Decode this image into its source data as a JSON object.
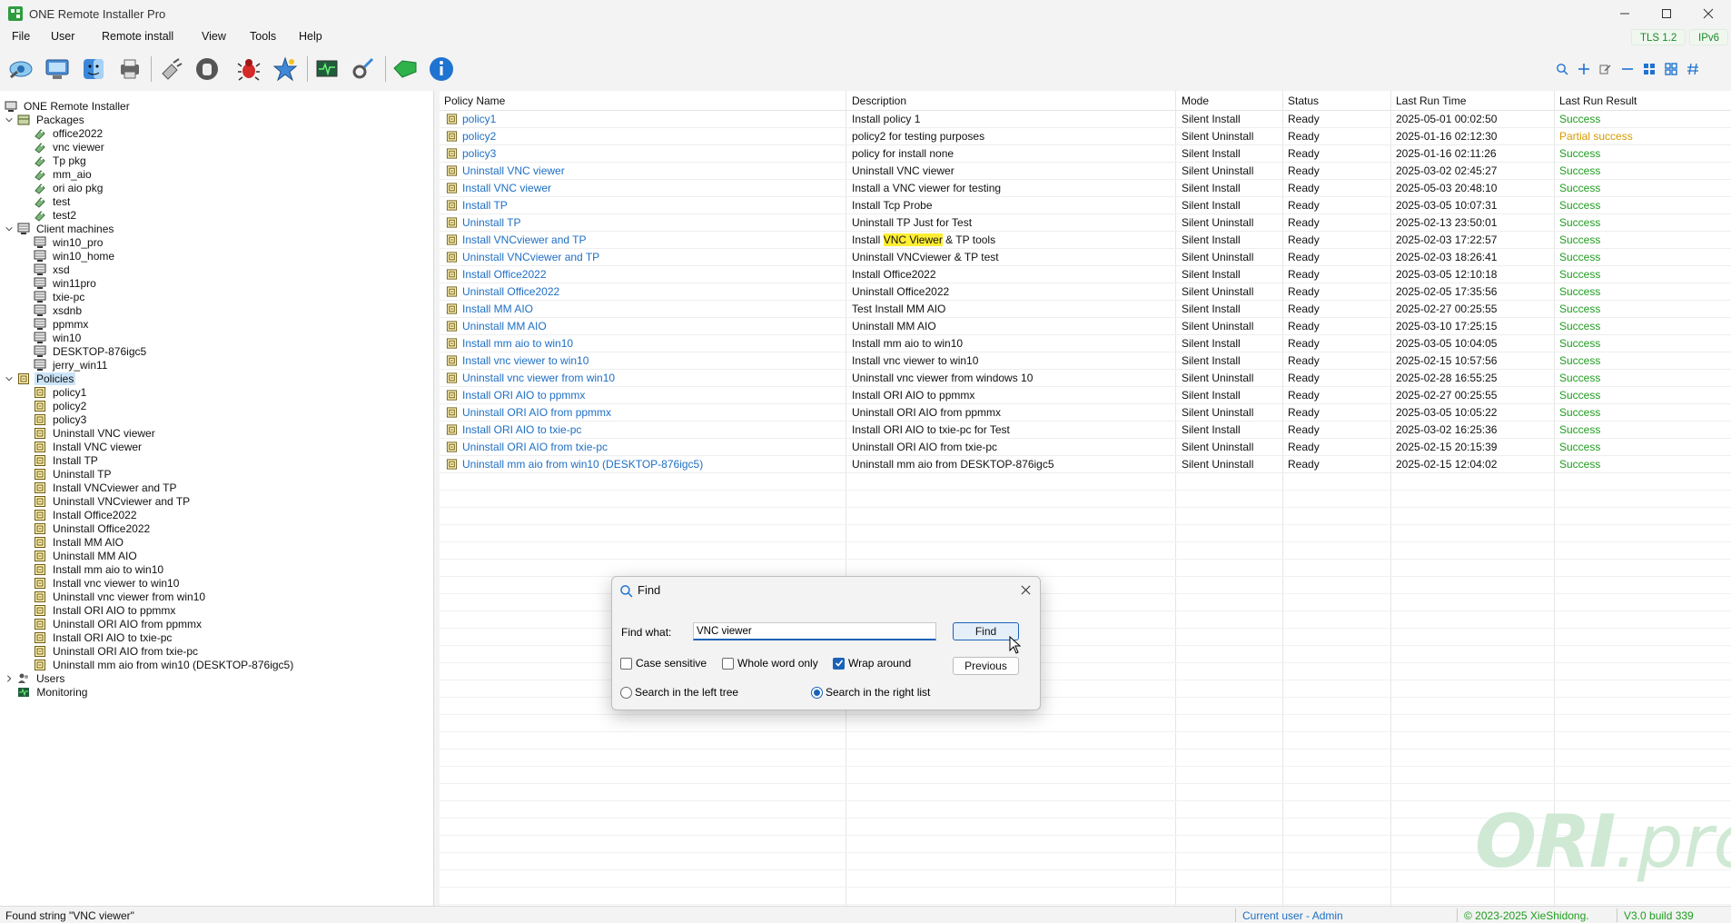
{
  "window": {
    "title": "ONE Remote Installer Pro",
    "minimize_icon": "minimize-icon",
    "maximize_icon": "maximize-icon",
    "close_icon": "close-icon"
  },
  "menu": {
    "items": [
      "File",
      "User",
      "Remote install",
      "View",
      "Tools",
      "Help"
    ],
    "tls": "TLS 1.2",
    "ipv": "IPv6"
  },
  "toolbar": {
    "icons": [
      "connect-eye-icon",
      "computer-scan-icon",
      "finder-icon",
      "printer-icon",
      "plugin-icon",
      "stop-hand-icon",
      "bug-icon",
      "star-burst-icon",
      "monitor-pulse-icon",
      "wrench-settings-icon",
      "tag-icon",
      "info-icon"
    ],
    "right_icons": [
      "search-icon",
      "add-icon",
      "edit-icon",
      "remove-icon",
      "grid-view-icon",
      "tile-view-icon",
      "hash-icon"
    ]
  },
  "tree": {
    "root": "ONE Remote Installer",
    "packages_label": "Packages",
    "packages": [
      "office2022",
      "vnc viewer",
      "Tp pkg",
      "mm_aio",
      "ori aio pkg",
      "test",
      "test2"
    ],
    "clients_label": "Client machines",
    "clients": [
      "win10_pro",
      "win10_home",
      "xsd",
      "win11pro",
      "txie-pc",
      "xsdnb",
      "ppmmx",
      "win10",
      "DESKTOP-876igc5",
      "jerry_win11"
    ],
    "policies_label": "Policies",
    "policies": [
      "policy1",
      "policy2",
      "policy3",
      "Uninstall VNC viewer",
      "Install VNC viewer",
      "Install TP",
      "Uninstall TP",
      "Install VNCviewer and TP",
      "Uninstall VNCviewer and TP",
      "Install Office2022",
      "Uninstall Office2022",
      "Install MM AIO",
      "Uninstall MM AIO",
      "Install mm aio to win10",
      "Install vnc viewer to win10",
      "Uninstall vnc viewer from win10",
      "Install ORI AIO to ppmmx",
      "Uninstall ORI AIO from ppmmx",
      "Install ORI AIO to txie-pc",
      "Uninstall ORI AIO from txie-pc",
      "Uninstall mm aio from win10 (DESKTOP-876igc5)"
    ],
    "users_label": "Users",
    "monitoring_label": "Monitoring"
  },
  "list": {
    "columns": [
      "Policy Name",
      "Description",
      "Mode",
      "Status",
      "Last Run Time",
      "Last Run Result"
    ],
    "rows": [
      {
        "name": "policy1",
        "desc": "Install policy 1",
        "mode": "Silent Install",
        "status": "Ready",
        "time": "2025-05-01 00:02:50",
        "result": "Success",
        "result_kind": "ok"
      },
      {
        "name": "policy2",
        "desc": "policy2 for testing purposes",
        "mode": "Silent Uninstall",
        "status": "Ready",
        "time": "2025-01-16 02:12:30",
        "result": "Partial success",
        "result_kind": "partial"
      },
      {
        "name": "policy3",
        "desc": "policy for install none",
        "mode": "Silent Install",
        "status": "Ready",
        "time": "2025-01-16 02:11:26",
        "result": "Success",
        "result_kind": "ok"
      },
      {
        "name": "Uninstall VNC viewer",
        "desc": "Uninstall VNC viewer",
        "mode": "Silent Uninstall",
        "status": "Ready",
        "time": "2025-03-02 02:45:27",
        "result": "Success",
        "result_kind": "ok"
      },
      {
        "name": "Install VNC viewer",
        "desc": "Install a VNC viewer for testing",
        "mode": "Silent Install",
        "status": "Ready",
        "time": "2025-05-03 20:48:10",
        "result": "Success",
        "result_kind": "ok"
      },
      {
        "name": "Install TP",
        "desc": "Install Tcp Probe",
        "mode": "Silent Install",
        "status": "Ready",
        "time": "2025-03-05 10:07:31",
        "result": "Success",
        "result_kind": "ok"
      },
      {
        "name": "Uninstall TP",
        "desc": "Uninstall TP Just for Test",
        "mode": "Silent Uninstall",
        "status": "Ready",
        "time": "2025-02-13 23:50:01",
        "result": "Success",
        "result_kind": "ok"
      },
      {
        "name": "Install VNCviewer and TP",
        "desc_pre": "Install ",
        "desc_hl": "VNC Viewer",
        "desc_post": " & TP tools",
        "mode": "Silent Install",
        "status": "Ready",
        "time": "2025-02-03 17:22:57",
        "result": "Success",
        "result_kind": "ok"
      },
      {
        "name": "Uninstall VNCviewer and TP",
        "desc": "Uninstall VNCviewer & TP test",
        "mode": "Silent Uninstall",
        "status": "Ready",
        "time": "2025-02-03 18:26:41",
        "result": "Success",
        "result_kind": "ok"
      },
      {
        "name": "Install Office2022",
        "desc": "Install Office2022",
        "mode": "Silent Install",
        "status": "Ready",
        "time": "2025-03-05 12:10:18",
        "result": "Success",
        "result_kind": "ok"
      },
      {
        "name": "Uninstall Office2022",
        "desc": "Uninstall Office2022",
        "mode": "Silent Uninstall",
        "status": "Ready",
        "time": "2025-02-05 17:35:56",
        "result": "Success",
        "result_kind": "ok"
      },
      {
        "name": "Install MM AIO",
        "desc": "Test Install MM AIO",
        "mode": "Silent Install",
        "status": "Ready",
        "time": "2025-02-27 00:25:55",
        "result": "Success",
        "result_kind": "ok"
      },
      {
        "name": "Uninstall MM AIO",
        "desc": "Uninstall MM AIO",
        "mode": "Silent Uninstall",
        "status": "Ready",
        "time": "2025-03-10 17:25:15",
        "result": "Success",
        "result_kind": "ok"
      },
      {
        "name": "Install mm aio to win10",
        "desc": "Install mm aio to win10",
        "mode": "Silent Install",
        "status": "Ready",
        "time": "2025-03-05 10:04:05",
        "result": "Success",
        "result_kind": "ok"
      },
      {
        "name": "Install vnc viewer to win10",
        "desc": "Install vnc viewer to win10",
        "mode": "Silent Install",
        "status": "Ready",
        "time": "2025-02-15 10:57:56",
        "result": "Success",
        "result_kind": "ok"
      },
      {
        "name": "Uninstall vnc viewer from win10",
        "desc": "Uninstall vnc viewer from windows 10",
        "mode": "Silent Uninstall",
        "status": "Ready",
        "time": "2025-02-28 16:55:25",
        "result": "Success",
        "result_kind": "ok"
      },
      {
        "name": "Install ORI AIO to ppmmx",
        "desc": "Install ORI AIO to ppmmx",
        "mode": "Silent Install",
        "status": "Ready",
        "time": "2025-02-27 00:25:55",
        "result": "Success",
        "result_kind": "ok"
      },
      {
        "name": "Uninstall ORI AIO from ppmmx",
        "desc": "Uninstall ORI AIO from ppmmx",
        "mode": "Silent Uninstall",
        "status": "Ready",
        "time": "2025-03-05 10:05:22",
        "result": "Success",
        "result_kind": "ok"
      },
      {
        "name": "Install ORI AIO to txie-pc",
        "desc": "Install ORI AIO to txie-pc for Test",
        "mode": "Silent Install",
        "status": "Ready",
        "time": "2025-03-02 16:25:36",
        "result": "Success",
        "result_kind": "ok"
      },
      {
        "name": "Uninstall ORI AIO from txie-pc",
        "desc": "Uninstall ORI AIO from txie-pc",
        "mode": "Silent Uninstall",
        "status": "Ready",
        "time": "2025-02-15 20:15:39",
        "result": "Success",
        "result_kind": "ok"
      },
      {
        "name": "Uninstall mm aio from win10 (DESKTOP-876igc5)",
        "desc": "Uninstall mm aio from DESKTOP-876igc5",
        "mode": "Silent Uninstall",
        "status": "Ready",
        "time": "2025-02-15 12:04:02",
        "result": "Success",
        "result_kind": "ok"
      }
    ]
  },
  "watermark": {
    "main": "ORI",
    "suffix": ".pro"
  },
  "find_dialog": {
    "title": "Find",
    "find_label": "Find what:",
    "find_value": "VNC viewer",
    "find_button": "Find",
    "previous_button": "Previous",
    "case_sensitive": "Case sensitive",
    "whole_word": "Whole word only",
    "wrap_around": "Wrap around",
    "search_left": "Search in the left tree",
    "search_right": "Search in the right list",
    "checks": {
      "case_sensitive": false,
      "whole_word": false,
      "wrap_around": true
    },
    "scope": "right"
  },
  "status": {
    "message": "Found string \"VNC viewer\"",
    "current_user": "Current user - Admin",
    "copyright": "© 2023-2025 XieShidong.",
    "version": "V3.0 build 339"
  },
  "colors": {
    "link": "#1e6fc4",
    "success": "#1f9d1f",
    "partial": "#d79b00",
    "highlight": "#ffee33",
    "accent": "#1a62b8"
  }
}
